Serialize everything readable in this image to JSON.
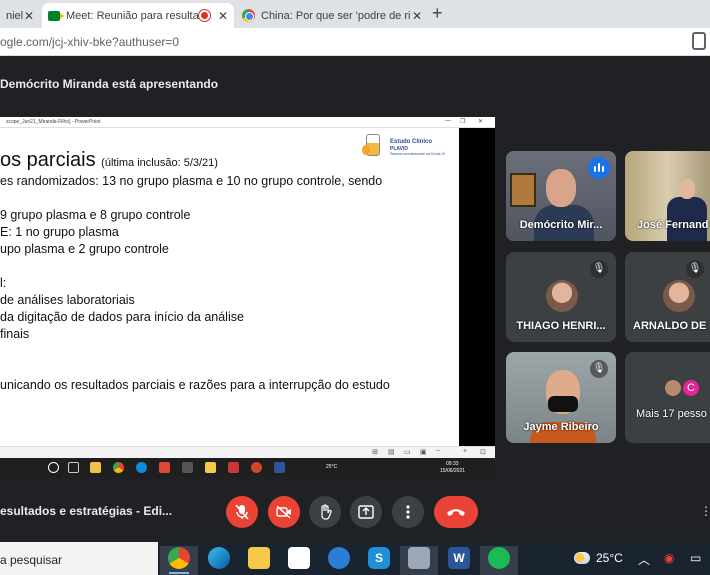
{
  "browser": {
    "tabs": [
      {
        "title": "niel"
      },
      {
        "title": "Meet: Reunião para resultad"
      },
      {
        "title": "China: Por que ser 'podre de ricc"
      }
    ],
    "url_prefix": "ogle.com/jcj-xhiv-bke?authuser=0",
    "new_tab": "+"
  },
  "meet": {
    "presenter_banner": "Demócrito Miranda está apresentando",
    "meeting_name": "esultados e estratégias - Edi..."
  },
  "shared_window": {
    "titlebar": "scope_Jun21_Miranda-Filho] - PowerPoint",
    "logo": {
      "line1": "Estudo Clínico",
      "line2": "PLAVID",
      "line3": "Plasma convalescente na Covid-19"
    },
    "slide": {
      "title": "os parciais",
      "title_sub": "(última inclusão: 5/3/21)",
      "lines": [
        "es randomizados: 13 no grupo plasma e 10 no grupo controle, sendo",
        "9 grupo plasma e 8 grupo controle",
        "E: 1 no grupo plasma",
        "upo plasma e 2 grupo controle",
        "l:",
        " de análises laboratoriais",
        "da digitação de dados para início da análise",
        "finais",
        "unicando os resultados parciais e razões para a interrupção do estudo"
      ]
    },
    "taskbar": {
      "temp": "25°C",
      "time": "09:33",
      "date": "15/06/2021"
    }
  },
  "participants": [
    {
      "name": "Demócrito Mir...",
      "speaking": true
    },
    {
      "name": "José Fernand"
    },
    {
      "name": "THIAGO HENRI..."
    },
    {
      "name": "ARNALDO DE"
    },
    {
      "name": "Jayme Ribeiro"
    },
    {
      "name": "Mais 17 pesso",
      "avatar_letter": "C"
    }
  ],
  "controls": {
    "mic": "mic-off-icon",
    "camera": "camera-off-icon",
    "hand": "raise-hand-icon",
    "present": "present-icon",
    "more": "more-icon",
    "leave": "end-call-icon"
  },
  "windows_taskbar": {
    "search_placeholder": "a pesquisar",
    "weather_temp": "25°C"
  },
  "colors": {
    "meet_bg": "#202124",
    "tile_bg": "#3c4043",
    "end_call": "#ea4335",
    "speaking_outline": "#8ab4f8"
  }
}
